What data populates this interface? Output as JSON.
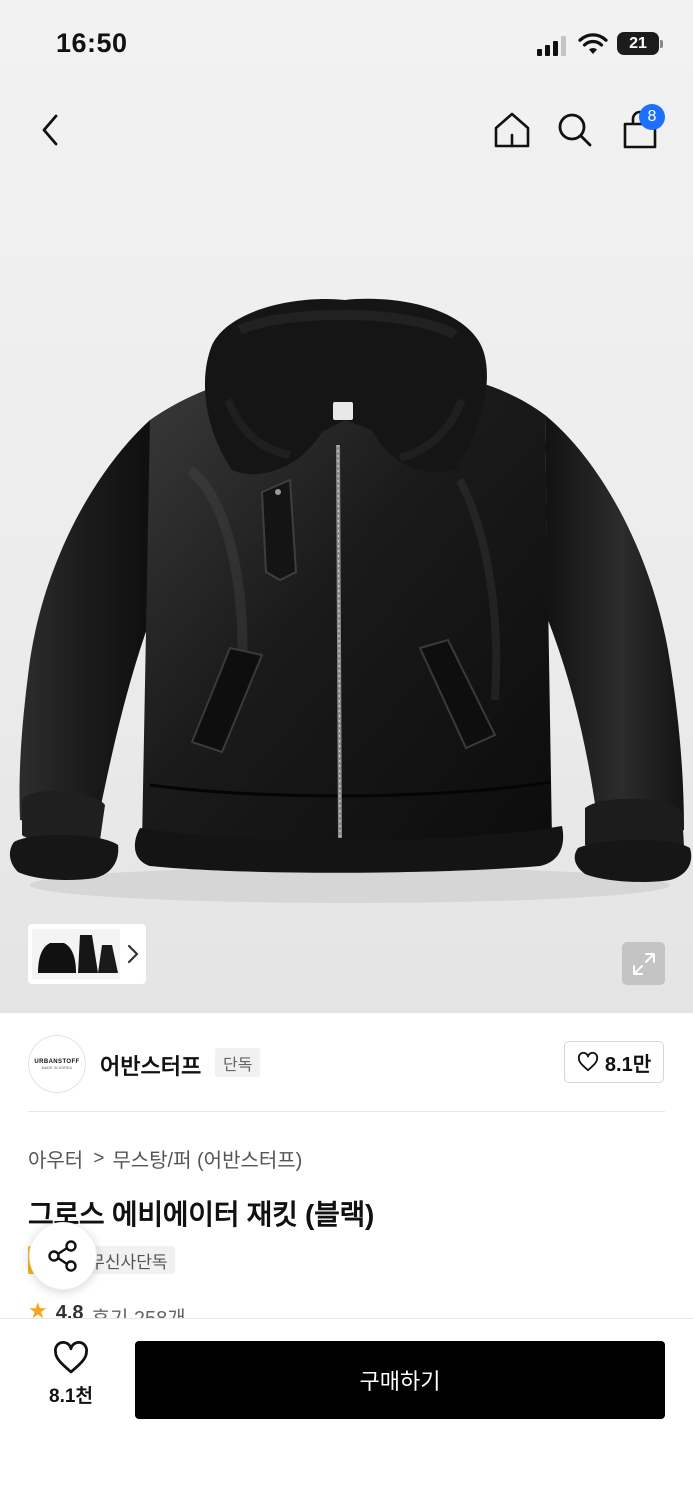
{
  "status_bar": {
    "time": "16:50",
    "battery": "21"
  },
  "nav": {
    "cart_count": "8"
  },
  "brand": {
    "logo_text": "URBANSTOFF",
    "logo_sub": "MADE IN KOREA",
    "name": "어반스터프",
    "badge": "단독",
    "like_count": "8.1만"
  },
  "breadcrumb": [
    "아우터",
    "무스탕/퍼 (어반스터프)"
  ],
  "breadcrumb_sep": ">",
  "product": {
    "title": "그로스 에비에이터 재킷 (블랙)",
    "tags": [
      "세일",
      "무신사단독"
    ],
    "rating": "4.8",
    "reviews": "후기 258개"
  },
  "bottom_bar": {
    "like_count": "8.1천",
    "buy_label": "구매하기"
  },
  "icons": {
    "back": "back-arrow-icon",
    "home": "home-icon",
    "search": "search-icon",
    "cart": "shopping-bag-icon",
    "expand": "expand-icon",
    "share": "share-icon",
    "heart": "heart-icon",
    "star": "star-icon"
  },
  "colors": {
    "buy_button": "#000000",
    "cart_badge": "#1f6fff",
    "sale_tag": "#f7b218",
    "star": "#f7a41b"
  }
}
